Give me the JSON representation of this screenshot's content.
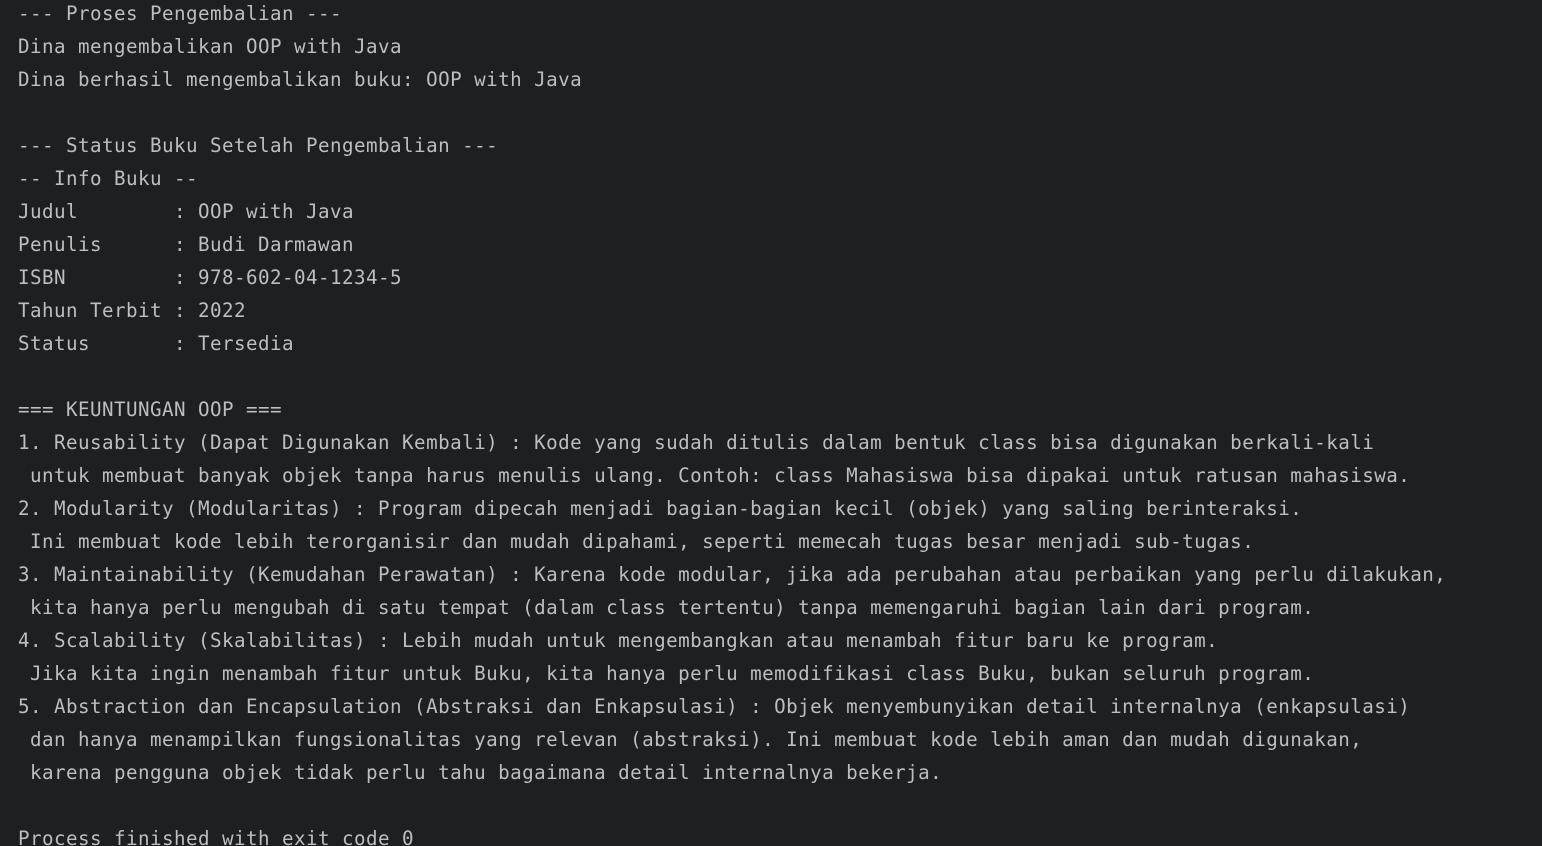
{
  "console": {
    "lines": [
      "--- Proses Pengembalian ---",
      "Dina mengembalikan OOP with Java",
      "Dina berhasil mengembalikan buku: OOP with Java",
      "",
      "--- Status Buku Setelah Pengembalian ---",
      "-- Info Buku --",
      "Judul        : OOP with Java",
      "Penulis      : Budi Darmawan",
      "ISBN         : 978-602-04-1234-5",
      "Tahun Terbit : 2022",
      "Status       : Tersedia",
      "",
      "=== KEUNTUNGAN OOP ===",
      "1. Reusability (Dapat Digunakan Kembali) : Kode yang sudah ditulis dalam bentuk class bisa digunakan berkali-kali",
      " untuk membuat banyak objek tanpa harus menulis ulang. Contoh: class Mahasiswa bisa dipakai untuk ratusan mahasiswa.",
      "2. Modularity (Modularitas) : Program dipecah menjadi bagian-bagian kecil (objek) yang saling berinteraksi.",
      " Ini membuat kode lebih terorganisir dan mudah dipahami, seperti memecah tugas besar menjadi sub-tugas.",
      "3. Maintainability (Kemudahan Perawatan) : Karena kode modular, jika ada perubahan atau perbaikan yang perlu dilakukan,",
      " kita hanya perlu mengubah di satu tempat (dalam class tertentu) tanpa memengaruhi bagian lain dari program.",
      "4. Scalability (Skalabilitas) : Lebih mudah untuk mengembangkan atau menambah fitur baru ke program.",
      " Jika kita ingin menambah fitur untuk Buku, kita hanya perlu memodifikasi class Buku, bukan seluruh program.",
      "5. Abstraction dan Encapsulation (Abstraksi dan Enkapsulasi) : Objek menyembunyikan detail internalnya (enkapsulasi)",
      " dan hanya menampilkan fungsionalitas yang relevan (abstraksi). Ini membuat kode lebih aman dan mudah digunakan,",
      " karena pengguna objek tidak perlu tahu bagaimana detail internalnya bekerja.",
      "",
      "Process finished with exit code 0"
    ]
  },
  "colors": {
    "background": "#1e1f22",
    "text": "#bcbec4"
  }
}
